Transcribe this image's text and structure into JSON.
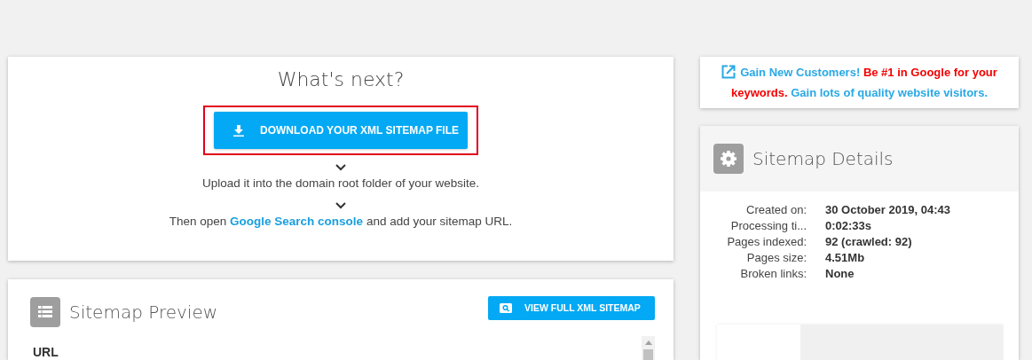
{
  "next_steps": {
    "title": "What's next?",
    "download_button": "DOWNLOAD YOUR XML SITEMAP FILE",
    "download_highlighted": true,
    "step_upload": "Upload it into the domain root folder of your website.",
    "step_open_before": "Then open",
    "step_open_link": "Google Search console",
    "step_open_after": "and add your sitemap URL."
  },
  "preview": {
    "title": "Sitemap Preview",
    "view_button": "VIEW FULL XML SITEMAP",
    "columns": [
      "URL"
    ]
  },
  "promo": {
    "parts": [
      {
        "text": "Gain New Customers!",
        "kind": "link"
      },
      {
        "text": "Be #1 in Google for your keywords.",
        "kind": "alert"
      },
      {
        "text": "Gain lots of quality website visitors.",
        "kind": "link"
      }
    ]
  },
  "details": {
    "title": "Sitemap Details",
    "rows": [
      {
        "label": "Created on:",
        "value": "30 October 2019, 04:43"
      },
      {
        "label": "Processing ti...",
        "value": "0:02:33s"
      },
      {
        "label": "Pages indexed:",
        "value": "92 (crawled: 92)"
      },
      {
        "label": "Pages size:",
        "value": "4.51Mb"
      },
      {
        "label": "Broken links:",
        "value": "None"
      }
    ]
  }
}
